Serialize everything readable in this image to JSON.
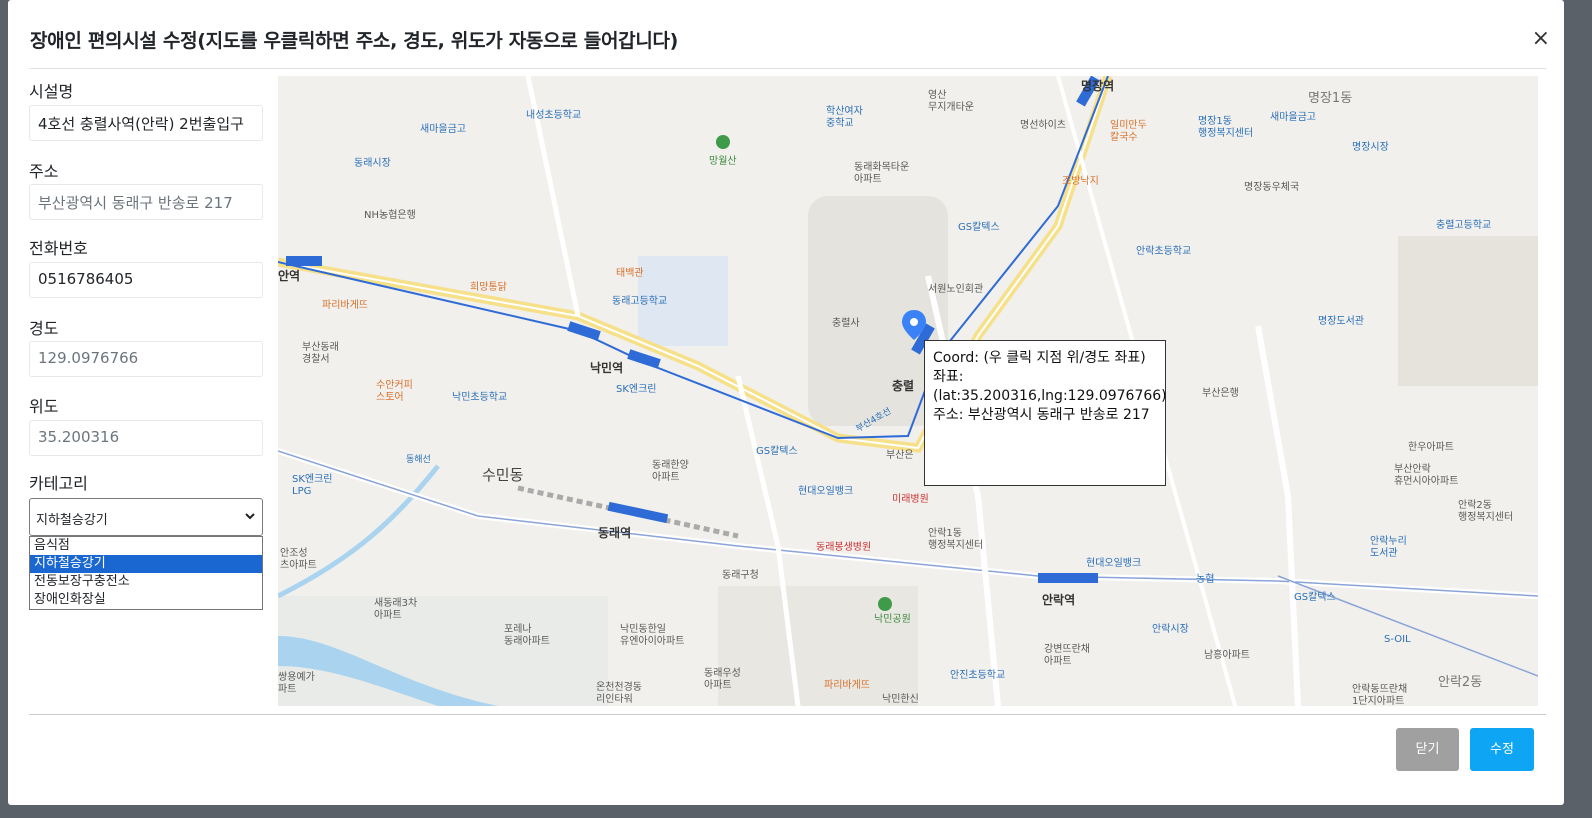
{
  "modal": {
    "title": "장애인 편의시설 수정(지도를 우클릭하면 주소, 경도, 위도가 자동으로 들어갑니다)",
    "close_glyph": "×"
  },
  "form": {
    "name_label": "시설명",
    "name_value": "4호선 충렬사역(안락) 2번출입구",
    "address_label": "주소",
    "address_value": "부산광역시 동래구 반송로 217",
    "phone_label": "전화번호",
    "phone_value": "0516786405",
    "lng_label": "경도",
    "lng_value": "129.0976766",
    "lat_label": "위도",
    "lat_value": "35.200316",
    "category_label": "카테고리",
    "category_selected": "지하철승강기",
    "category_options": [
      "음식점",
      "지하철승강기",
      "전동보장구충전소",
      "장애인화장실"
    ]
  },
  "infowindow": {
    "line1": "Coord: (우 클릭 지점 위/경도 좌표)",
    "line2": "좌표: (lat:35.200316,lng:129.0976766)",
    "line3": "주소: 부산광역시 동래구 반송로 217"
  },
  "map_labels": {
    "myeongjang_station": "명장역",
    "naemin_station": "낙민역",
    "chungryeol_station": "충렬",
    "dongnae_station": "동래역",
    "anrak_station": "안락역",
    "an_station": "안역",
    "sumin_dong": "수민동",
    "myeongjang1dong": "명장1동",
    "anrak2dong": "안락2동",
    "naeseongcho": "내성초등학교",
    "hakssan_girls": "학산여자\n중학교",
    "yeongsan": "영산\n무지개타운",
    "saemaeul_school": "새마을금고",
    "dongnae_market": "동래시장",
    "manwolsan": "망월산",
    "nh_bank": "NH농협은행",
    "dongnae_hwamok": "동래화목타운\n아파트",
    "myeongseon": "명선하이츠",
    "ilmi": "일미만두\n칼국수",
    "jobangnakji": "조방낙지",
    "myeongjang_post": "명장동우체국",
    "myeongjang_market": "명장시장",
    "myeongjang_welfare": "명장1동\n행정복지센터",
    "saemaeul_right": "새마을금고",
    "chungryeol_high": "충렬고등학교",
    "anrak_elementary": "안락초등학교",
    "gs_caltex_top": "GS칼텍스",
    "taebaek": "태백관",
    "huimang": "희망통닭",
    "dongnae_high": "동래고등학교",
    "paris_left": "파리바게뜨",
    "busan_dongnae_police": "부산동래\n경찰서",
    "suan_coffee": "수안커피\n스토어",
    "naemin_elementary": "낙민초등학교",
    "sk_enclean": "SK엔크린",
    "chungryeolsa": "충렬사",
    "seowon_senior": "서원노인회관",
    "myeongjang_library": "명장도서관",
    "busan_bank": "부산은행",
    "gs_caltex_mid": "GS칼텍스",
    "hyundai_oilbank": "현대오일뱅크",
    "mirae_hospital": "미래병원",
    "dongnae_hanyang": "동래한양\n아파트",
    "sk_lpg": "SK엔크린\nLPG",
    "dongnae_bongsaeng": "동래봉생병원",
    "anrak1dong": "안락1동\n행정복지센터",
    "hyundai_oilbank2": "현대오일뱅크",
    "nonghyup": "농협",
    "gs_caltex_right": "GS칼텍스",
    "anrak_market": "안락시장",
    "soil": "S-OIL",
    "anjo": "안조성\n츠아파트",
    "saedong_3": "새동래3차\n아파트",
    "porena": "포레나\n동래아파트",
    "naemin_dongil": "낙민동한일\n유엔아이아파트",
    "dongnae_gucheong": "동래구청",
    "naemin_park": "낙민공원",
    "gangbyeon": "강변뜨란채\n아파트",
    "namheung": "남흥아파트",
    "anrak_nuri": "안락누리\n도서관",
    "anrak2dong_center": "안락2동\n행정복지센터",
    "busan_anrak": "부산안락\n휴먼시아아파트",
    "hanwoo": "한우아파트",
    "anjin": "안진초등학교",
    "oncheon": "온천천경동\n리인타워",
    "dongnae_woosung": "동래우성\n아파트",
    "paris_bottom": "파리바게뜨",
    "anrak_dong_park": "안락동뜨란채\n1단지아파트",
    "naemin_hansin": "낙민한신",
    "ssangyong": "쌍용예가\n파트",
    "donghae_line": "동해선",
    "busan_line4": "부산4호선",
    "busan_o": "부산은"
  },
  "buttons": {
    "close_label": "닫기",
    "save_label": "수정"
  },
  "colors": {
    "subway_blue": "#2f6bd6",
    "primary_button": "#0ea5f4",
    "secondary_button": "#a0a0a0",
    "selected_option": "#1a67d2"
  }
}
